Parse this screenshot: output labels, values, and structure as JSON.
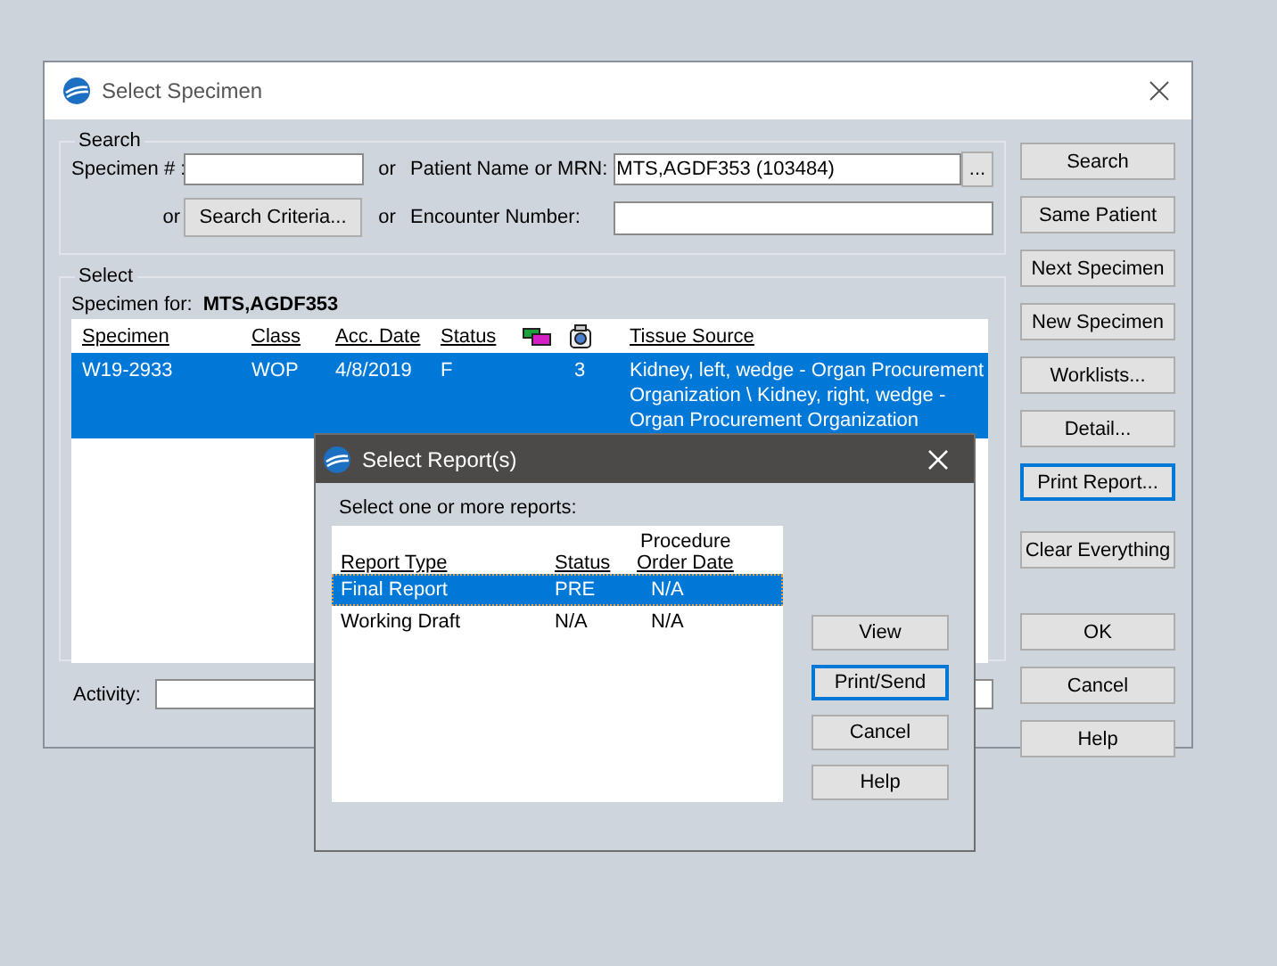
{
  "window": {
    "title": "Select Specimen"
  },
  "search": {
    "legend": "Search",
    "specimen_label": "Specimen # :",
    "or_1": "or",
    "patient_label": "Patient Name or MRN:",
    "patient_value": "MTS,AGDF353 (103484)",
    "browse_button": "...",
    "or_2": "or",
    "criteria_button": "Search Criteria...",
    "or_3": "or",
    "encounter_label": "Encounter Number:"
  },
  "select": {
    "legend": "Select",
    "specimen_for_label": "Specimen for:",
    "specimen_for_value": "MTS,AGDF353",
    "columns": [
      {
        "kind": "text",
        "label": "Specimen"
      },
      {
        "kind": "text",
        "label": "Class"
      },
      {
        "kind": "text",
        "label": "Acc. Date"
      },
      {
        "kind": "text",
        "label": "Status"
      },
      {
        "kind": "tubes"
      },
      {
        "kind": "camera"
      },
      {
        "kind": "text",
        "label": "Tissue Source"
      }
    ],
    "rows": [
      {
        "selected": true,
        "specimen": "W19-2933",
        "class": "WOP",
        "acc_date": "4/8/2019",
        "status": "F",
        "column_6": "3",
        "tissue_source": "Kidney, left, wedge - Organ Procurement Organization \\ Kidney, right, wedge - Organ Procurement Organization"
      }
    ]
  },
  "activity": {
    "label": "Activity:"
  },
  "buttons": [
    {
      "label": "Search",
      "focused": false
    },
    {
      "label": "Same Patient",
      "focused": false
    },
    {
      "label": "Next Specimen",
      "focused": false
    },
    {
      "label": "New Specimen",
      "focused": false
    },
    {
      "label": "Worklists...",
      "focused": false
    },
    {
      "label": "Detail...",
      "focused": false
    },
    {
      "label": "Print Report...",
      "focused": true
    },
    {
      "label": "Clear Everything",
      "focused": false
    },
    {
      "label": "OK",
      "focused": false
    },
    {
      "label": "Cancel",
      "focused": false
    },
    {
      "label": "Help",
      "focused": false
    }
  ],
  "dialog": {
    "title": "Select Report(s)",
    "prompt": "Select one or more reports:",
    "columns": [
      {
        "label": "Report Type"
      },
      {
        "label": "Status"
      },
      {
        "over_label": "Procedure",
        "label": "Order Date"
      }
    ],
    "rows": [
      {
        "selected": true,
        "cells": [
          "Final Report",
          "PRE",
          "N/A"
        ]
      },
      {
        "selected": false,
        "cells": [
          "Working Draft",
          "N/A",
          "N/A"
        ]
      }
    ],
    "buttons": [
      {
        "label": "View",
        "focused": false
      },
      {
        "label": "Print/Send",
        "focused": true
      },
      {
        "label": "Cancel",
        "focused": false
      },
      {
        "label": "Help",
        "focused": false
      }
    ]
  }
}
